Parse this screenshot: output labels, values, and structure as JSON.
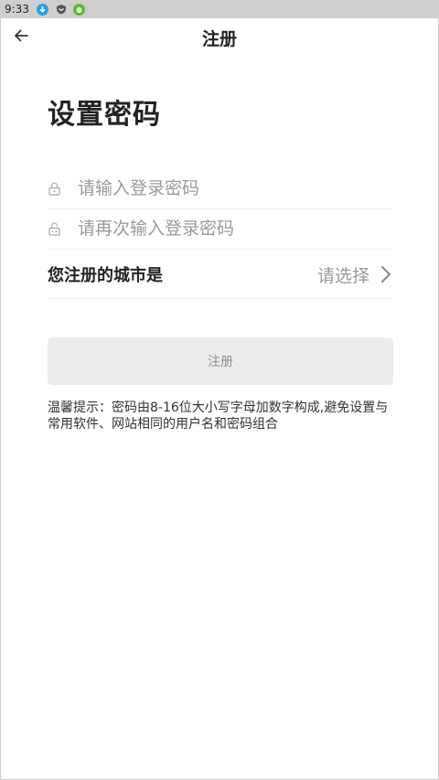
{
  "status_bar": {
    "time": "9:33",
    "icons": [
      "download-notification-icon",
      "shield-notification-icon",
      "android-notification-icon"
    ]
  },
  "header": {
    "back_icon": "arrow-left-icon",
    "title": "注册"
  },
  "page": {
    "title": "设置密码"
  },
  "form": {
    "password": {
      "icon": "lock-icon",
      "value": "",
      "placeholder": "请输入登录密码"
    },
    "password_confirm": {
      "icon": "lock-open-icon",
      "value": "",
      "placeholder": "请再次输入登录密码"
    },
    "city": {
      "label": "您注册的城市是",
      "value": "请选择",
      "icon": "chevron-right-icon"
    }
  },
  "register_button": {
    "label": "注册"
  },
  "tip": "温馨提示：密码由8-16位大小写字母加数字构成,避免设置与常用软件、网站相同的用户名和密码组合",
  "colors": {
    "status_bar": "#cfcfcf",
    "placeholder": "#9a9a9a",
    "button_bg": "#ececec",
    "button_text": "#8f8f8f",
    "divider": "#ededed"
  }
}
